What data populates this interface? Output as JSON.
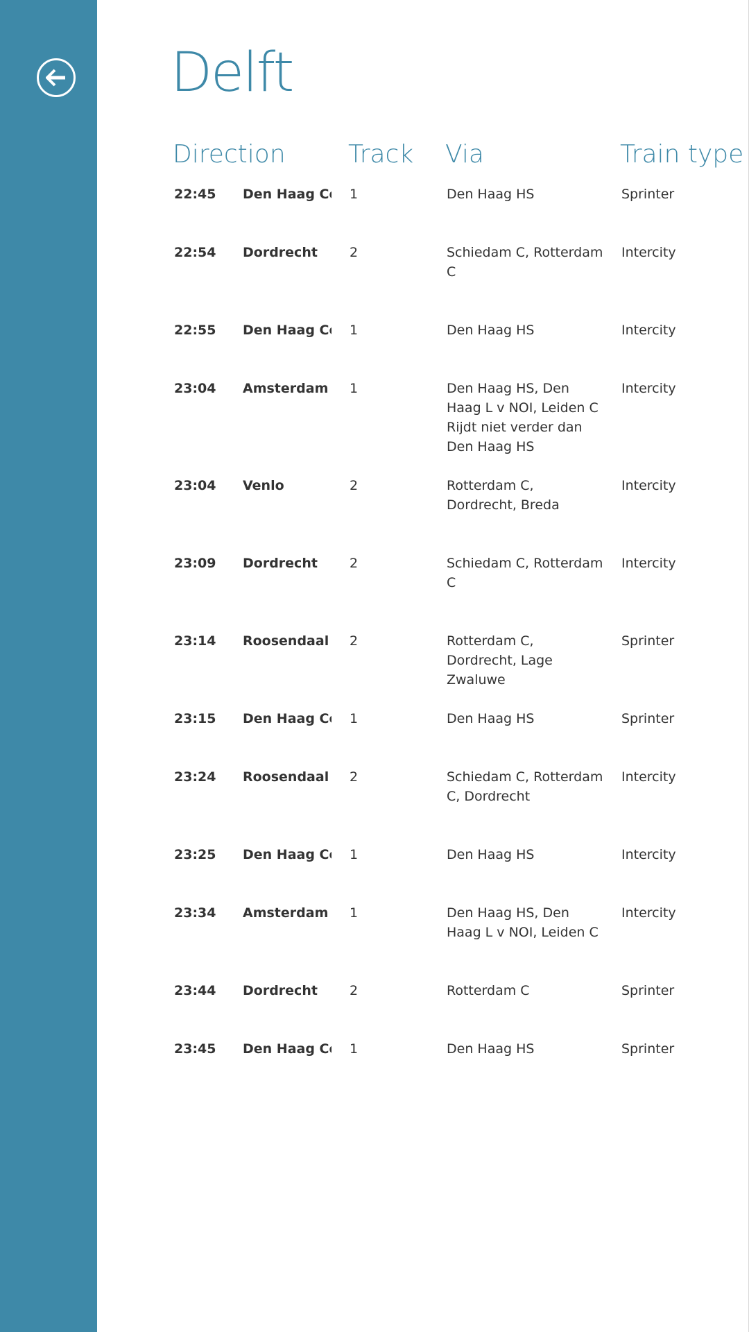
{
  "station": {
    "title": "Delft"
  },
  "nav": {
    "back_icon": "back-arrow-circle-icon"
  },
  "columns": {
    "direction": "Direction",
    "track": "Track",
    "via": "Via",
    "train_type": "Train type"
  },
  "colors": {
    "accent": "#3e89a8",
    "text": "#333333"
  },
  "departures": [
    {
      "time": "22:45",
      "direction": "Den Haag Centraal",
      "track": "1",
      "via": "Den Haag HS",
      "note": "",
      "type": "Sprinter"
    },
    {
      "time": "22:54",
      "direction": "Dordrecht",
      "track": "2",
      "via": "Schiedam C, Rotterdam C",
      "note": "",
      "type": "Intercity"
    },
    {
      "time": "22:55",
      "direction": "Den Haag Centraal",
      "track": "1",
      "via": "Den Haag HS",
      "note": "",
      "type": "Intercity"
    },
    {
      "time": "23:04",
      "direction": "Amsterdam Centraal",
      "track": "1",
      "via": "Den Haag HS, Den Haag L v NOI, Leiden C",
      "note": "Rijdt niet verder dan Den Haag HS",
      "type": "Intercity"
    },
    {
      "time": "23:04",
      "direction": "Venlo",
      "track": "2",
      "via": "Rotterdam C, Dordrecht, Breda",
      "note": "",
      "type": "Intercity"
    },
    {
      "time": "23:09",
      "direction": "Dordrecht",
      "track": "2",
      "via": "Schiedam C, Rotterdam C",
      "note": "",
      "type": "Intercity"
    },
    {
      "time": "23:14",
      "direction": "Roosendaal",
      "track": "2",
      "via": "Rotterdam C, Dordrecht, Lage Zwaluwe",
      "note": "",
      "type": "Sprinter"
    },
    {
      "time": "23:15",
      "direction": "Den Haag Centraal",
      "track": "1",
      "via": "Den Haag HS",
      "note": "",
      "type": "Sprinter"
    },
    {
      "time": "23:24",
      "direction": "Roosendaal",
      "track": "2",
      "via": "Schiedam C, Rotterdam C, Dordrecht",
      "note": "",
      "type": "Intercity"
    },
    {
      "time": "23:25",
      "direction": "Den Haag Centraal",
      "track": "1",
      "via": "Den Haag HS",
      "note": "",
      "type": "Intercity"
    },
    {
      "time": "23:34",
      "direction": "Amsterdam Centraal",
      "track": "1",
      "via": "Den Haag HS, Den Haag L v NOI, Leiden C",
      "note": "",
      "type": "Intercity"
    },
    {
      "time": "23:44",
      "direction": "Dordrecht",
      "track": "2",
      "via": "Rotterdam C",
      "note": "",
      "type": "Sprinter"
    },
    {
      "time": "23:45",
      "direction": "Den Haag Centraal",
      "track": "1",
      "via": "Den Haag HS",
      "note": "",
      "type": "Sprinter"
    }
  ]
}
